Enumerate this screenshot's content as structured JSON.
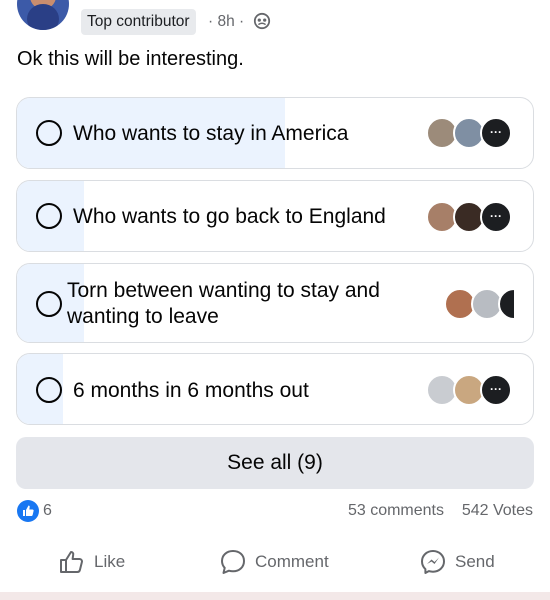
{
  "post": {
    "badge": "Top contributor",
    "time": "· 8h ·",
    "text": "Ok this will be interesting."
  },
  "poll": {
    "options": [
      {
        "label": "Who wants to stay in America",
        "fill": 0.52
      },
      {
        "label": "Who wants to go back to England",
        "fill": 0.13
      },
      {
        "label_line1": "Torn between wanting to stay and",
        "label_line2": "wanting to leave",
        "fill": 0.13
      },
      {
        "label": "6 months in 6 months out",
        "fill": 0.09
      }
    ],
    "more_glyph": "···",
    "see_all": "See all (9)"
  },
  "stats": {
    "reactions": "6",
    "comments": "53 comments",
    "votes": "542 Votes"
  },
  "actions": {
    "like": "Like",
    "comment": "Comment",
    "send": "Send"
  },
  "colors": {
    "accent": "#1877f2",
    "fill": "#ebf3fe",
    "muted": "#65676b"
  }
}
